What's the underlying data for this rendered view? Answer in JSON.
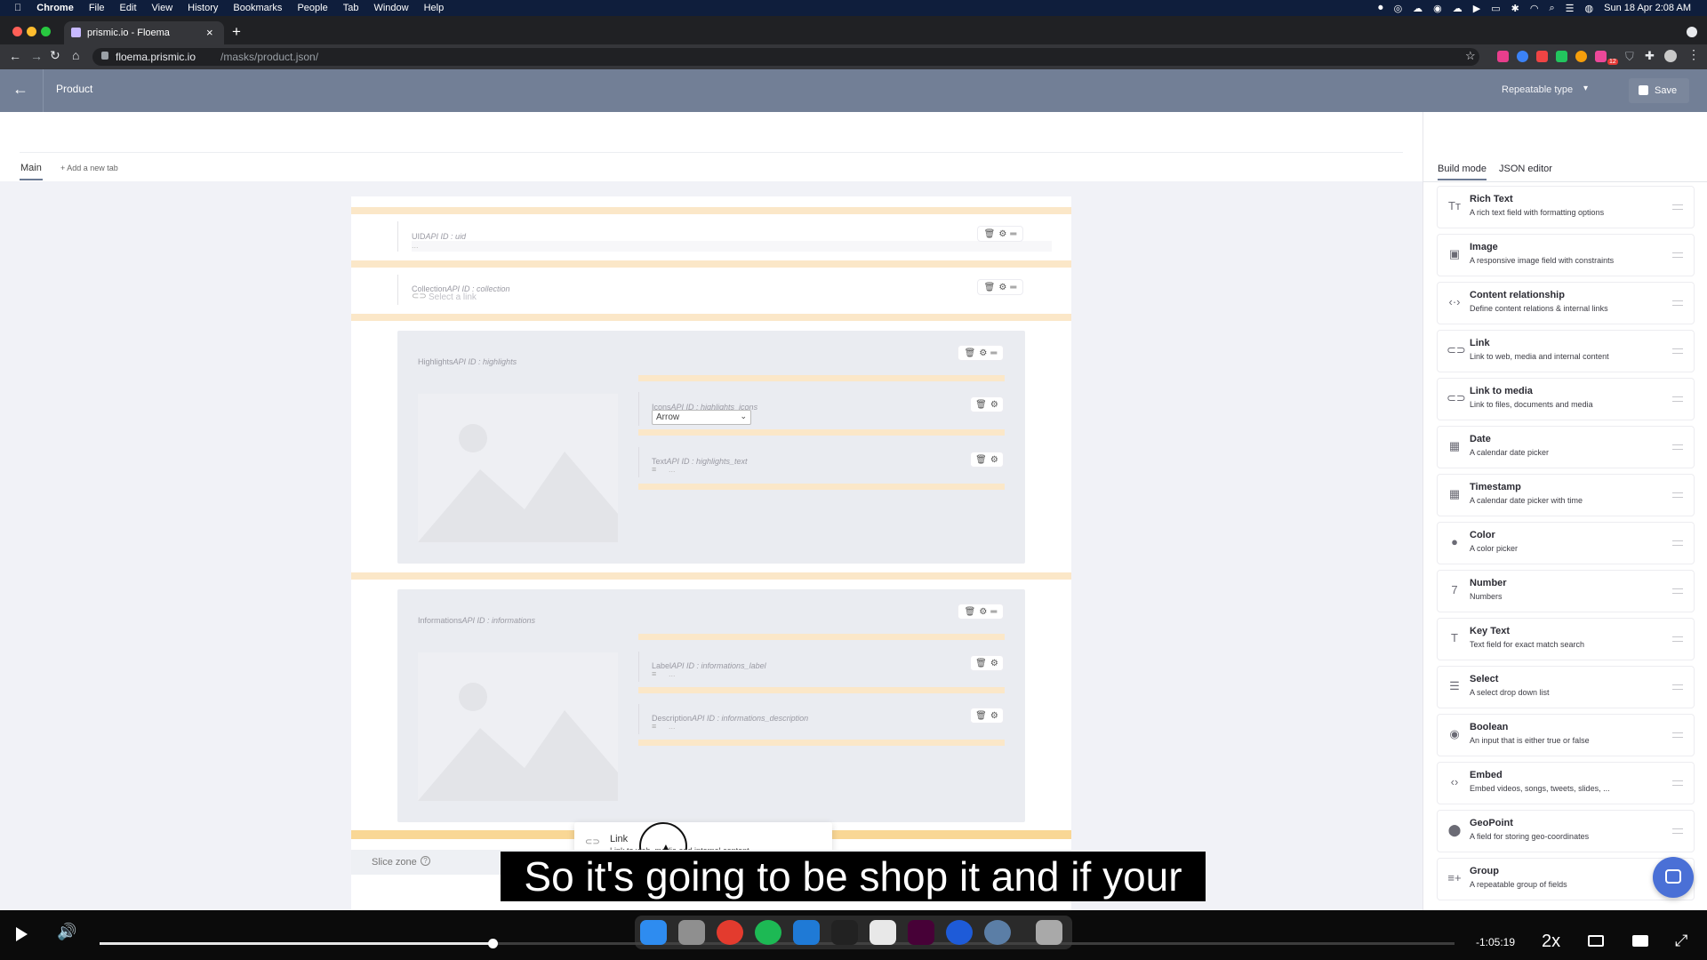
{
  "menubar": {
    "app_name": "Chrome",
    "items": [
      "File",
      "Edit",
      "View",
      "History",
      "Bookmarks",
      "People",
      "Tab",
      "Window",
      "Help"
    ],
    "clock": "Sun 18 Apr  2:08 AM"
  },
  "browser": {
    "tab_title": "prismic.io - Floema",
    "url_host": "floema.prismic.io",
    "url_path": "/masks/product.json/",
    "extension_badge": "12"
  },
  "header": {
    "title": "Product",
    "type_select": "Repeatable type",
    "save_label": "Save"
  },
  "tabs": {
    "main": "Main",
    "add": "+ Add a new tab"
  },
  "fields": {
    "uid": {
      "label": "UID",
      "api": "API ID : uid",
      "placeholder": "..."
    },
    "collection": {
      "label": "Collection",
      "api": "API ID : collection",
      "placeholder": "Select a link"
    },
    "highlights": {
      "label": "Highlights",
      "api": "API ID : highlights"
    },
    "highlights_icons": {
      "label": "Icons",
      "api": "API ID : highlights_icons",
      "value": "Arrow"
    },
    "highlights_text": {
      "label": "Text",
      "api": "API ID : highlights_text",
      "placeholder": "..."
    },
    "informations": {
      "label": "Informations",
      "api": "API ID : informations"
    },
    "informations_label": {
      "label": "Label",
      "api": "API ID : informations_label",
      "placeholder": "..."
    },
    "informations_description": {
      "label": "Description",
      "api": "API ID : informations_description",
      "placeholder": "..."
    }
  },
  "drag_ghost": {
    "title": "Link",
    "desc": "Link to web, media and internal content"
  },
  "slice_zone": "Slice zone",
  "sidebar": {
    "modes": [
      "Build mode",
      "JSON editor"
    ],
    "widgets": [
      {
        "icon": "rich-text-icon",
        "glyph": "Tт",
        "title": "Rich Text",
        "desc": "A rich text field with formatting options"
      },
      {
        "icon": "image-icon",
        "glyph": "▣",
        "title": "Image",
        "desc": "A responsive image field with constraints"
      },
      {
        "icon": "content-relationship-icon",
        "glyph": "‹·›",
        "title": "Content relationship",
        "desc": "Define content relations & internal links"
      },
      {
        "icon": "link-icon",
        "glyph": "⊂⊃",
        "title": "Link",
        "desc": "Link to web, media and internal content"
      },
      {
        "icon": "link-to-media-icon",
        "glyph": "⊂⊃",
        "title": "Link to media",
        "desc": "Link to files, documents and media"
      },
      {
        "icon": "date-icon",
        "glyph": "▦",
        "title": "Date",
        "desc": "A calendar date picker"
      },
      {
        "icon": "timestamp-icon",
        "glyph": "▦",
        "title": "Timestamp",
        "desc": "A calendar date picker with time"
      },
      {
        "icon": "color-icon",
        "glyph": "●",
        "title": "Color",
        "desc": "A color picker"
      },
      {
        "icon": "number-icon",
        "glyph": "7",
        "title": "Number",
        "desc": "Numbers"
      },
      {
        "icon": "key-text-icon",
        "glyph": "T",
        "title": "Key Text",
        "desc": "Text field for exact match search"
      },
      {
        "icon": "select-icon",
        "glyph": "☰",
        "title": "Select",
        "desc": "A select drop down list"
      },
      {
        "icon": "boolean-icon",
        "glyph": "◉",
        "title": "Boolean",
        "desc": "An input that is either true or false"
      },
      {
        "icon": "embed-icon",
        "glyph": "‹›",
        "title": "Embed",
        "desc": "Embed videos, songs, tweets, slides, ..."
      },
      {
        "icon": "geopoint-icon",
        "glyph": "⬤",
        "title": "GeoPoint",
        "desc": "A field for storing geo-coordinates"
      },
      {
        "icon": "group-icon",
        "glyph": "≡+",
        "title": "Group",
        "desc": "A repeatable group of fields"
      }
    ]
  },
  "video": {
    "caption": "So it's going to be shop it and if your",
    "time_remaining": "-1:05:19",
    "speed": "2x",
    "progress": 0.29
  }
}
